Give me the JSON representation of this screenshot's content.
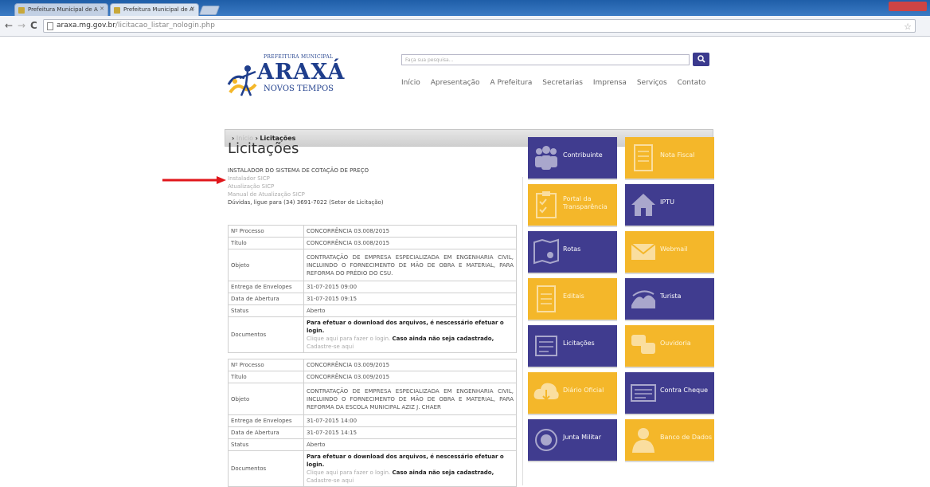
{
  "browser": {
    "tabs": [
      {
        "title": "Prefeitura Municipal de A"
      },
      {
        "title": "Prefeitura Municipal de A"
      }
    ],
    "url_host": "araxa.mg.gov.br",
    "url_path": "/licitacao_listar_nologin.php"
  },
  "header": {
    "logo_top": "PREFEITURA MUNICIPAL",
    "logo_main": "ARAXÁ",
    "logo_sub": "NOVOS TEMPOS",
    "search_placeholder": "Faça sua pesquisa...",
    "menu": [
      "Início",
      "Apresentação",
      "A Prefeitura",
      "Secretarias",
      "Imprensa",
      "Serviços",
      "Contato"
    ]
  },
  "breadcrumb": {
    "home": "Início",
    "current": "Licitações"
  },
  "page_title": "Licitações",
  "intro": {
    "heading": "INSTALADOR DO SISTEMA DE COTAÇÃO DE PREÇO",
    "links": [
      "Instalador SICP",
      "Atualização SICP",
      "Manual de Atualização SICP"
    ],
    "help": "Dúvidas, ligue para (34) 3691-7022 (Setor de Licitação)"
  },
  "labels": {
    "processo": "Nº Processo",
    "titulo": "Título",
    "objeto": "Objeto",
    "entrega": "Entrega de Envelopes",
    "abertura": "Data de Abertura",
    "status": "Status",
    "documentos": "Documentos"
  },
  "docs_text": {
    "msg": "Para efetuar o download dos arquivos, é nescessário efetuar o login.",
    "link_login": "Clique aqui para fazer o login.",
    "msg2": "Caso ainda não seja cadastrado,",
    "link_register": "Cadastre-se aqui"
  },
  "licitacoes": [
    {
      "processo": "CONCORRÊNCIA 03.008/2015",
      "titulo": "CONCORRÊNCIA 03.008/2015",
      "objeto": "CONTRATAÇÃO DE EMPRESA ESPECIALIZADA EM ENGENHARIA CIVIL, INCLUINDO O FORNECIMENTO DE MÃO DE OBRA E MATERIAL, PARA REFORMA DO PRÉDIO DO CSU.",
      "entrega": "31-07-2015 09:00",
      "abertura": "31-07-2015 09:15",
      "status": "Aberto"
    },
    {
      "processo": "CONCORRÊNCIA 03.009/2015",
      "titulo": "CONCORRÊNCIA 03.009/2015",
      "objeto": "CONTRATAÇÃO DE EMPRESA ESPECIALIZADA EM ENGENHARIA CIVIL, INCLUINDO O FORNECIMENTO DE MÃO DE OBRA E MATERIAL, PARA REFORMA DA ESCOLA MUNICIPAL AZIZ J. CHAER",
      "entrega": "31-07-2015 14:00",
      "abertura": "31-07-2015 14:15",
      "status": "Aberto"
    }
  ],
  "tiles": [
    {
      "label": "Contribuinte",
      "color": "blue",
      "icon": "people-icon"
    },
    {
      "label": "Nota Fiscal",
      "color": "yellow",
      "icon": "document-icon"
    },
    {
      "label": "Portal da Transparência",
      "color": "yellow",
      "icon": "clipboard-icon"
    },
    {
      "label": "IPTU",
      "color": "blue",
      "icon": "house-icon"
    },
    {
      "label": "Rotas",
      "color": "blue",
      "icon": "map-icon"
    },
    {
      "label": "Webmail",
      "color": "yellow",
      "icon": "envelope-icon"
    },
    {
      "label": "Editais",
      "color": "yellow",
      "icon": "document-icon"
    },
    {
      "label": "Turista",
      "color": "blue",
      "icon": "landscape-icon"
    },
    {
      "label": "Licitações",
      "color": "blue",
      "icon": "scroll-icon"
    },
    {
      "label": "Ouvidoria",
      "color": "yellow",
      "icon": "chat-icon"
    },
    {
      "label": "Diário Oficial",
      "color": "yellow",
      "icon": "cloud-download-icon"
    },
    {
      "label": "Contra Cheque",
      "color": "blue",
      "icon": "cheque-icon"
    },
    {
      "label": "Junta Militar",
      "color": "blue",
      "icon": "emblem-icon"
    },
    {
      "label": "Banco de Dados",
      "color": "yellow",
      "icon": "person-icon"
    }
  ],
  "colors": {
    "tile_blue": "#403c8f",
    "tile_yellow": "#f4b72a",
    "brand": "#1f3e8c"
  }
}
